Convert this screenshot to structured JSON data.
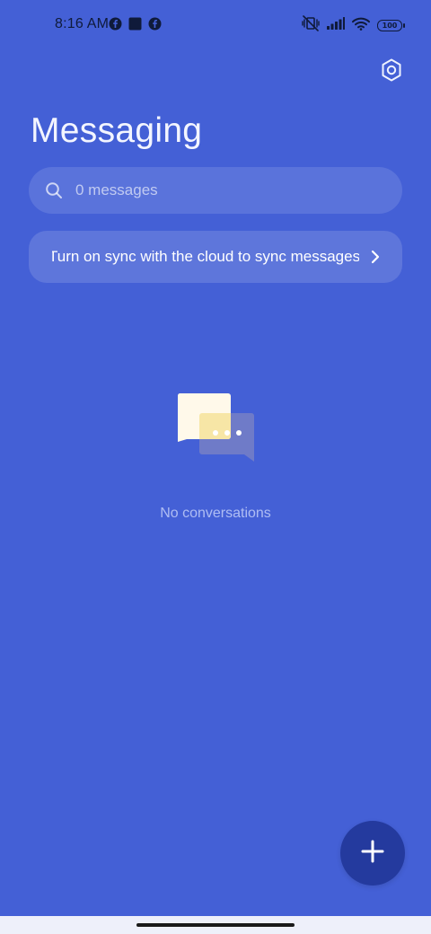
{
  "status_bar": {
    "time": "8:16 AM",
    "battery_level": "100",
    "left_icons": [
      "fb-icon",
      "square-app-icon",
      "fb-icon"
    ],
    "right_icons": [
      "vibrate-mute-icon",
      "signal-icon",
      "wifi-icon",
      "battery-icon"
    ]
  },
  "header": {
    "title": "Messaging",
    "settings_icon": "settings-hexagon-icon"
  },
  "search": {
    "placeholder": "0 messages",
    "value": ""
  },
  "sync_banner": {
    "text": "Turn on sync with the cloud to sync messages"
  },
  "empty_state": {
    "text": "No conversations",
    "illustration_icon": "chat-bubbles-icon"
  },
  "fab": {
    "icon": "plus-icon"
  },
  "colors": {
    "background": "#4460D6",
    "fab": "#243A9E",
    "bubble_front": "#FFF9EA",
    "bubble_back": "#6F7BC8",
    "bubble_overlap": "#F7E6A6"
  }
}
